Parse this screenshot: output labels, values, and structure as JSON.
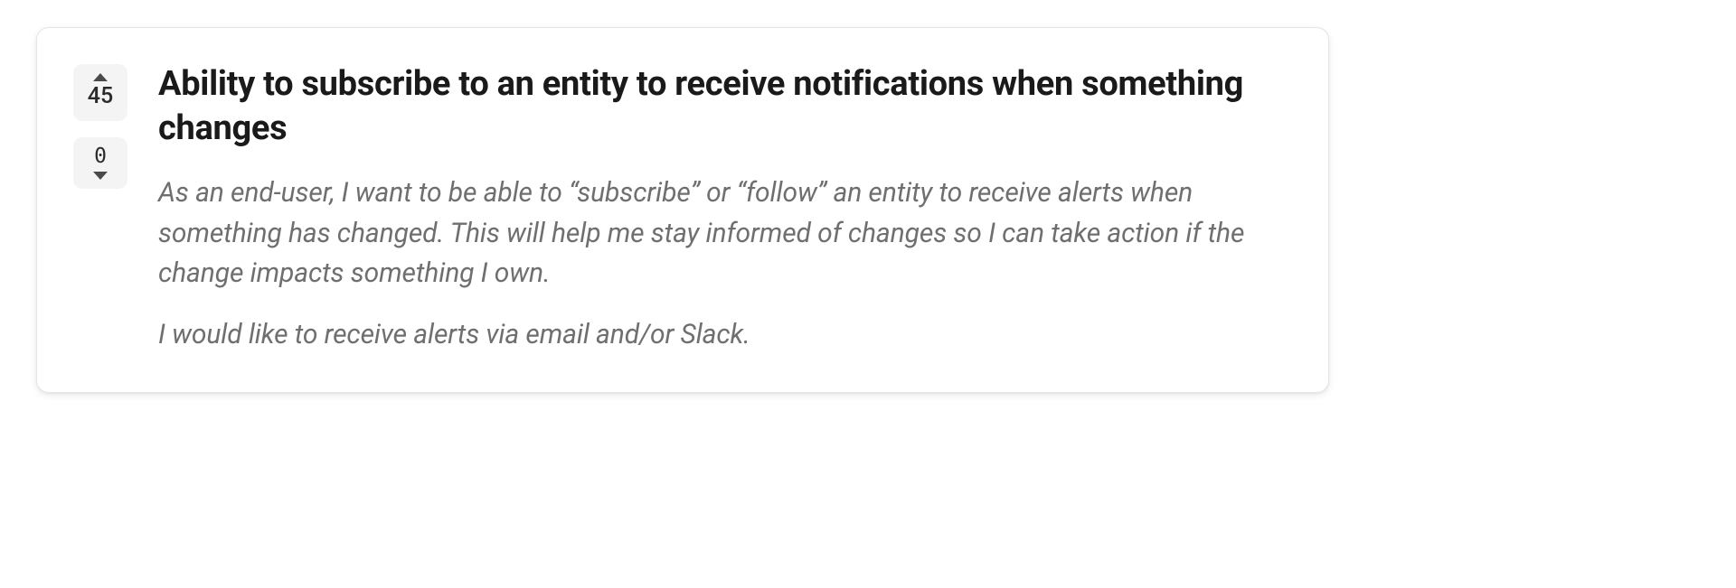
{
  "card": {
    "vote": {
      "upvotes": "45",
      "downvotes": "0"
    },
    "title": "Ability to subscribe to an entity to receive notifications when something changes",
    "body": {
      "p1": "As an end-user, I want to be able to “subscribe” or “follow” an entity to receive alerts when something has changed. This will help me stay informed of changes so I can take action if the change impacts something I own.",
      "p2": "I would like to receive alerts via email and/or Slack."
    }
  }
}
